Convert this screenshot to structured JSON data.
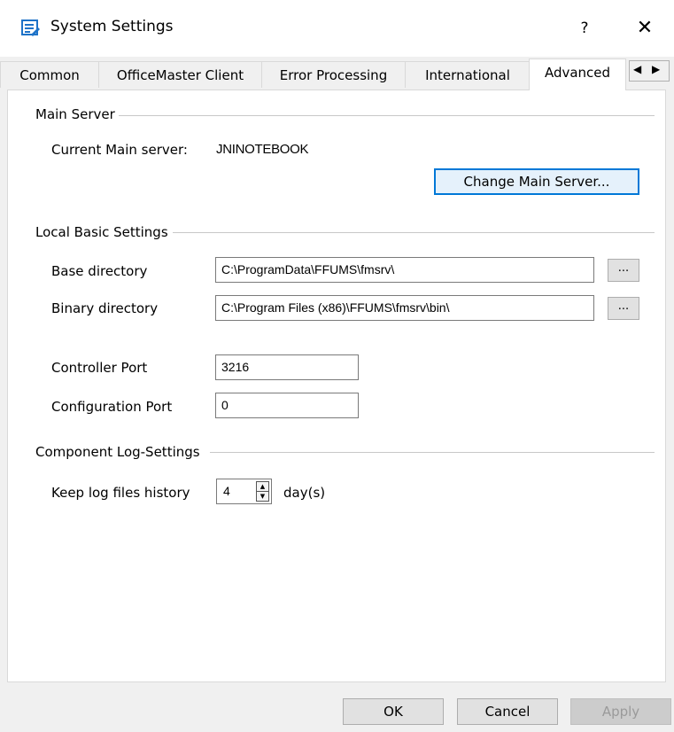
{
  "window": {
    "title": "System Settings",
    "help_label": "?",
    "close_label": "✕"
  },
  "tabs": [
    {
      "label": "Common"
    },
    {
      "label": "OfficeMaster Client"
    },
    {
      "label": "Error Processing"
    },
    {
      "label": "International"
    },
    {
      "label": "Advanced",
      "active": true
    }
  ],
  "tab_scroll": {
    "left": "◀",
    "right": "▶"
  },
  "main_server": {
    "group_title": "Main Server",
    "current_label": "Current Main server:",
    "current_value": "JNINOTEBOOK",
    "change_button": "Change Main Server..."
  },
  "local_basic": {
    "group_title": "Local Basic Settings",
    "base_dir_label": "Base directory",
    "base_dir_value": "C:\\ProgramData\\FFUMS\\fmsrv\\",
    "binary_dir_label": "Binary directory",
    "binary_dir_value": "C:\\Program Files (x86)\\FFUMS\\fmsrv\\bin\\",
    "browse_label": "...",
    "controller_port_label": "Controller Port",
    "controller_port_value": "3216",
    "config_port_label": "Configuration Port",
    "config_port_value": "0"
  },
  "log_settings": {
    "group_title": "Component Log-Settings",
    "keep_history_label": "Keep log files history",
    "keep_history_value": "4",
    "unit_label": "day(s)"
  },
  "footer": {
    "ok_label": "OK",
    "cancel_label": "Cancel",
    "apply_label": "Apply"
  },
  "colors": {
    "accent": "#0078d7",
    "panel_bg": "#ffffff",
    "window_bg": "#f0f0f0"
  }
}
